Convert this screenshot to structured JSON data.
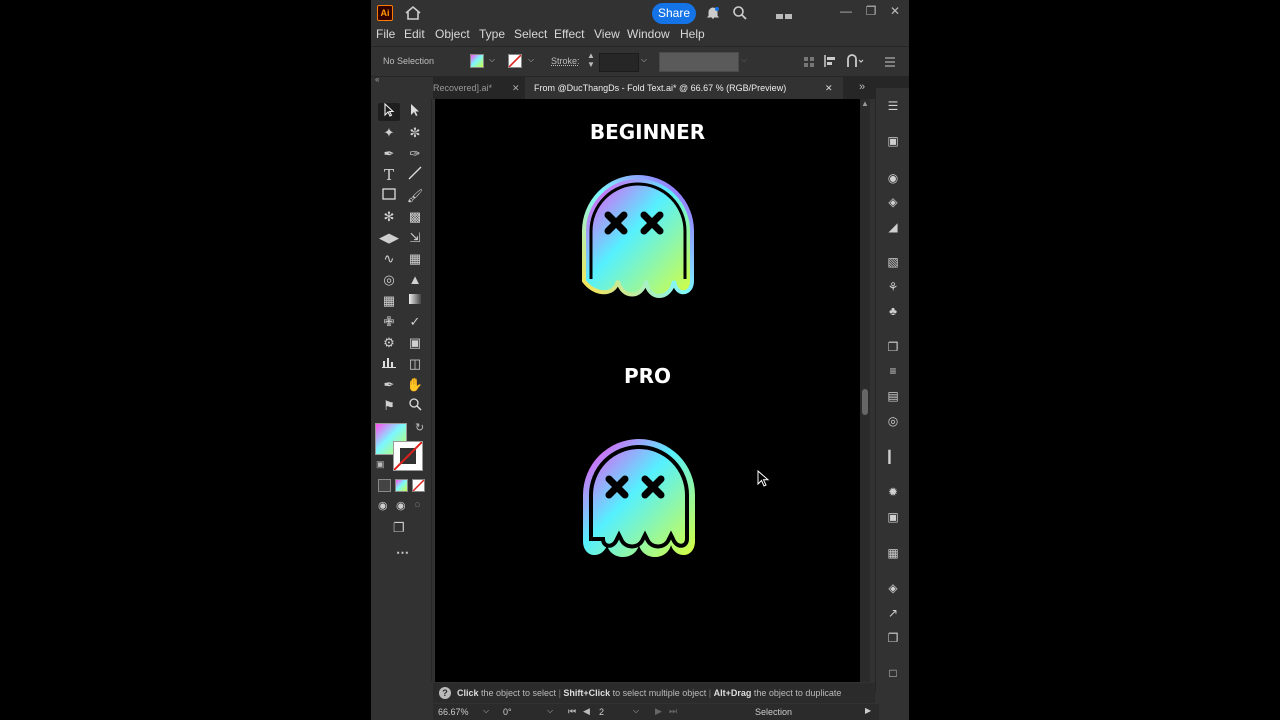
{
  "app": {
    "logo": "Ai",
    "share_label": "Share"
  },
  "menu": [
    "File",
    "Edit",
    "Object",
    "Type",
    "Select",
    "Effect",
    "View",
    "Window",
    "Help"
  ],
  "control": {
    "selection": "No Selection",
    "stroke_label": "Stroke:"
  },
  "tabs": [
    {
      "label": "Recovered].ai*",
      "active": false
    },
    {
      "label": "From @DucThangDs - Fold Text.ai* @ 66.67 % (RGB/Preview)",
      "active": true
    }
  ],
  "artboard": {
    "top_label": "BEGINNER",
    "bottom_label": "PRO"
  },
  "hint": {
    "k1": "Click",
    "t1": " the object to select ",
    "k2": "Shift+Click",
    "t2": " to select multiple object ",
    "k3": "Alt+Drag",
    "t3": " the object to duplicate"
  },
  "status": {
    "zoom": "66.67%",
    "rotation": "0°",
    "artboard_number": "2",
    "tool": "Selection"
  },
  "colors": {
    "accent": "#1473e6",
    "ui_bg": "#323232",
    "canvas": "#000000"
  }
}
